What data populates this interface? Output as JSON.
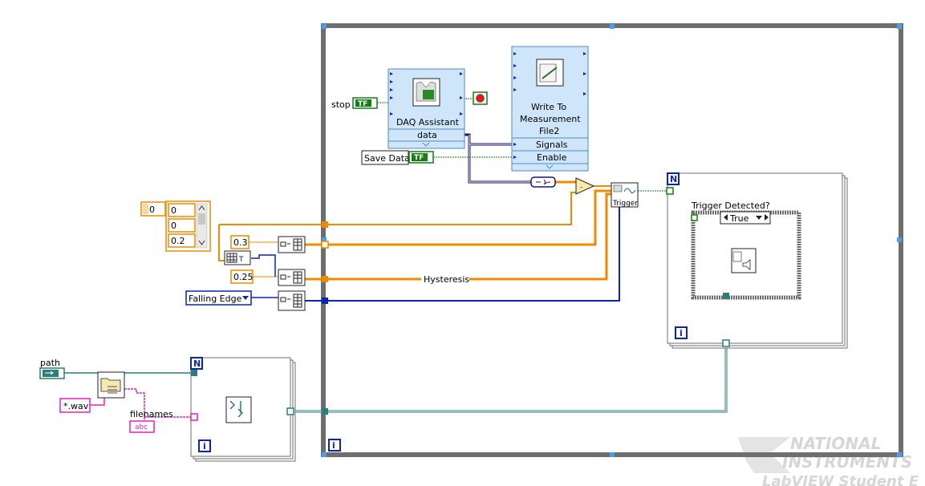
{
  "labels": {
    "stop": "stop",
    "tf": "TF",
    "save_data": "Save Data",
    "daq_title": "DAQ Assistant",
    "daq_output": "data",
    "write_title_1": "Write To",
    "write_title_2": "Measurement",
    "write_title_3": "File2",
    "write_signals": "Signals",
    "write_enable": "Enable",
    "trigger": "Trigger",
    "trigger_detected": "Trigger Detected?",
    "case_selector": "True",
    "hysteresis": "Hysteresis",
    "path": "path",
    "wav_pattern": "*.wav",
    "filenames": "filenames",
    "abc": "abc",
    "loop_n": "N",
    "loop_i": "i"
  },
  "constants": {
    "index_value": "0",
    "array_values": [
      "0",
      "0",
      "0.2"
    ],
    "level_1": "0.3",
    "level_2": "0.25",
    "edge_mode": "Falling Edge"
  },
  "watermark": {
    "line1": "NATIONAL",
    "line2": "INSTRUMENTS",
    "line3": "LabVIEW Student E"
  },
  "colors": {
    "orange_wire": "#f08a00",
    "blue_wire": "#0b24b8",
    "teal_wire": "#2b7f78",
    "pink_wire": "#e81ec6",
    "green_bool": "#108010",
    "loop_frame": "#6e6e6e",
    "express_fill": "#cfe6fa"
  }
}
